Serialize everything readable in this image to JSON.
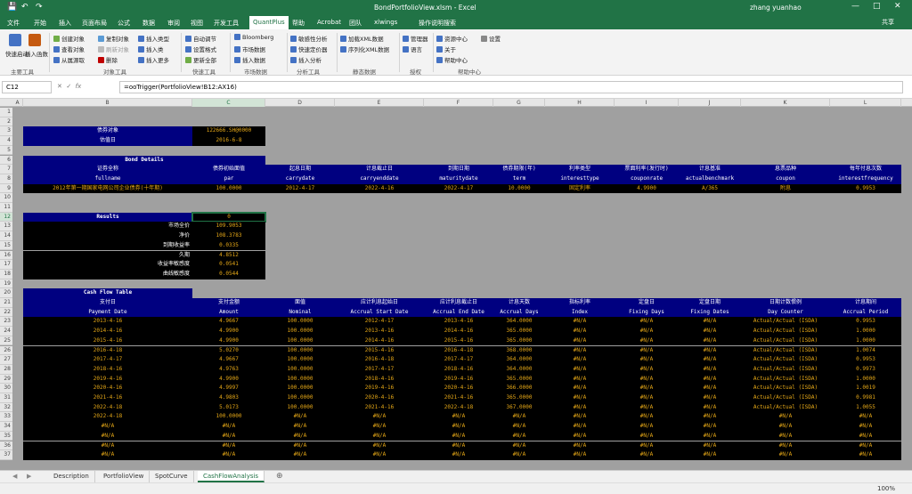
{
  "window": {
    "title": "BondPortfolioView.xlsm  -  Excel",
    "user": "zhang yuanhao"
  },
  "menu_tabs": [
    "文件",
    "开始",
    "插入",
    "页面布局",
    "公式",
    "数据",
    "审阅",
    "视图",
    "开发工具",
    "QuantPlus",
    "帮助",
    "Acrobat",
    "团队",
    "xlwings",
    "操作说明搜索"
  ],
  "active_tab": "QuantPlus",
  "share_label": "共享",
  "ribbon": {
    "groups": [
      {
        "label": "主要工具",
        "items": [
          "快速启动",
          "插入函数"
        ]
      },
      {
        "label": "对象工具",
        "items": [
          "创建对象",
          "查看对象",
          "从属源取",
          "复制对象",
          "刷新对象",
          "删除",
          "插入类型",
          "插入类",
          "插入更多"
        ]
      },
      {
        "label": "快速工具",
        "items": [
          "自动调节",
          "设置格式",
          "更新全部"
        ]
      },
      {
        "label": "市场数据",
        "items": [
          "Bloomberg",
          "市场数据",
          "插入数据"
        ]
      },
      {
        "label": "分析工具",
        "items": [
          "敏感性分析",
          "快速定价器",
          "插入分析"
        ]
      },
      {
        "label": "静态数据",
        "items": [
          "加载XML数据",
          "序列化XML数据"
        ]
      },
      {
        "label": "授权",
        "items": [
          "管理器",
          "语言"
        ]
      },
      {
        "label": "帮助中心",
        "items": [
          "资源中心",
          "关于",
          "帮助中心",
          "设置"
        ]
      }
    ]
  },
  "formula_bar": {
    "name_box": "C12",
    "formula": "=ooTrigger(PortfolioView!B12:AX16)"
  },
  "columns": [
    "A",
    "B",
    "C",
    "D",
    "E",
    "F",
    "G",
    "H",
    "I",
    "J",
    "K",
    "L"
  ],
  "rows": [
    "1",
    "2",
    "3",
    "4",
    "5",
    "6",
    "7",
    "8",
    "9",
    "10",
    "11",
    "12",
    "13",
    "14",
    "15",
    "16",
    "17",
    "18",
    "19",
    "20",
    "21",
    "22",
    "23",
    "24",
    "25",
    "26",
    "27",
    "28",
    "29",
    "30",
    "31",
    "32",
    "33",
    "34",
    "35",
    "36",
    "37"
  ],
  "bond_object": {
    "label1": "债券对象",
    "value1": "122666.SH@0000",
    "label2": "估值日",
    "value2": "2016-6-8"
  },
  "bond_details": {
    "title": "Bond Details",
    "cn_headers": [
      "证券全称",
      "债券初始面值",
      "起息日期",
      "计息截止日",
      "到期日期",
      "债券期限(年)",
      "利率类型",
      "票面利率(发行时)",
      "计息基准",
      "息票品种",
      "每年付息次数"
    ],
    "en_headers": [
      "fullname",
      "par",
      "carrydate",
      "carryenddate",
      "maturitydate",
      "term",
      "interesttype",
      "couponrate",
      "actualbenchmark",
      "coupon",
      "interestfrequency"
    ],
    "values": [
      "2012年第一期国家电网公司企业债券(十年期)",
      "100.0000",
      "2012-4-17",
      "2022-4-16",
      "2022-4-17",
      "10.0000",
      "固定利率",
      "4.9900",
      "A/365",
      "附息",
      "0.9953"
    ]
  },
  "results": {
    "title": "Results",
    "top_value": "0",
    "rows": [
      {
        "label": "市场全价",
        "value": "109.9053"
      },
      {
        "label": "净价",
        "value": "108.3783"
      },
      {
        "label": "到期收益率",
        "value": "0.0335"
      },
      {
        "label": "久期",
        "value": "4.8512"
      },
      {
        "label": "收益率敏感度",
        "value": "0.0541"
      },
      {
        "label": "曲线敏感度",
        "value": "0.0544"
      }
    ]
  },
  "cash_flow": {
    "title": "Cash Flow Table",
    "cn_headers": [
      "支付日",
      "支付金额",
      "面值",
      "应计利息起始日",
      "应计利息截止日",
      "计息天数",
      "指标利率",
      "定盘日",
      "定盘日期",
      "日期计数惯例",
      "计息期间"
    ],
    "en_headers": [
      "Payment Date",
      "Amount",
      "Nominal",
      "Accrual Start Date",
      "Accrual End Date",
      "Accrual Days",
      "Index",
      "Fixing Days",
      "Fixing Dates",
      "Day Counter",
      "Accrual Period"
    ],
    "rows": [
      [
        "2013-4-16",
        "4.9667",
        "100.0000",
        "2012-4-17",
        "2013-4-16",
        "364.0000",
        "#N/A",
        "#N/A",
        "#N/A",
        "Actual/Actual (ISDA)",
        "0.9953"
      ],
      [
        "2014-4-16",
        "4.9900",
        "100.0000",
        "2013-4-16",
        "2014-4-16",
        "365.0000",
        "#N/A",
        "#N/A",
        "#N/A",
        "Actual/Actual (ISDA)",
        "1.0000"
      ],
      [
        "2015-4-16",
        "4.9900",
        "100.0000",
        "2014-4-16",
        "2015-4-16",
        "365.0000",
        "#N/A",
        "#N/A",
        "#N/A",
        "Actual/Actual (ISDA)",
        "1.0000"
      ],
      [
        "2016-4-18",
        "5.0270",
        "100.0000",
        "2015-4-16",
        "2016-4-18",
        "368.0000",
        "#N/A",
        "#N/A",
        "#N/A",
        "Actual/Actual (ISDA)",
        "1.0074"
      ],
      [
        "2017-4-17",
        "4.9667",
        "100.0000",
        "2016-4-18",
        "2017-4-17",
        "364.0000",
        "#N/A",
        "#N/A",
        "#N/A",
        "Actual/Actual (ISDA)",
        "0.9953"
      ],
      [
        "2018-4-16",
        "4.9763",
        "100.0000",
        "2017-4-17",
        "2018-4-16",
        "364.0000",
        "#N/A",
        "#N/A",
        "#N/A",
        "Actual/Actual (ISDA)",
        "0.9973"
      ],
      [
        "2019-4-16",
        "4.9900",
        "100.0000",
        "2018-4-16",
        "2019-4-16",
        "365.0000",
        "#N/A",
        "#N/A",
        "#N/A",
        "Actual/Actual (ISDA)",
        "1.0000"
      ],
      [
        "2020-4-16",
        "4.9997",
        "100.0000",
        "2019-4-16",
        "2020-4-16",
        "366.0000",
        "#N/A",
        "#N/A",
        "#N/A",
        "Actual/Actual (ISDA)",
        "1.0019"
      ],
      [
        "2021-4-16",
        "4.9803",
        "100.0000",
        "2020-4-16",
        "2021-4-16",
        "365.0000",
        "#N/A",
        "#N/A",
        "#N/A",
        "Actual/Actual (ISDA)",
        "0.9981"
      ],
      [
        "2022-4-18",
        "5.0173",
        "100.0000",
        "2021-4-16",
        "2022-4-18",
        "367.0000",
        "#N/A",
        "#N/A",
        "#N/A",
        "Actual/Actual (ISDA)",
        "1.0055"
      ],
      [
        "2022-4-18",
        "100.0000",
        "#N/A",
        "#N/A",
        "#N/A",
        "#N/A",
        "#N/A",
        "#N/A",
        "#N/A",
        "#N/A",
        "#N/A"
      ],
      [
        "#N/A",
        "#N/A",
        "#N/A",
        "#N/A",
        "#N/A",
        "#N/A",
        "#N/A",
        "#N/A",
        "#N/A",
        "#N/A",
        "#N/A"
      ],
      [
        "#N/A",
        "#N/A",
        "#N/A",
        "#N/A",
        "#N/A",
        "#N/A",
        "#N/A",
        "#N/A",
        "#N/A",
        "#N/A",
        "#N/A"
      ],
      [
        "#N/A",
        "#N/A",
        "#N/A",
        "#N/A",
        "#N/A",
        "#N/A",
        "#N/A",
        "#N/A",
        "#N/A",
        "#N/A",
        "#N/A"
      ],
      [
        "#N/A",
        "#N/A",
        "#N/A",
        "#N/A",
        "#N/A",
        "#N/A",
        "#N/A",
        "#N/A",
        "#N/A",
        "#N/A",
        "#N/A"
      ]
    ]
  },
  "sheet_tabs": [
    "Description",
    "PortfolioView",
    "SpotCurve",
    "CashFlowAnalysis"
  ],
  "active_sheet": "CashFlowAnalysis",
  "zoom": "100%",
  "colors": {
    "excel_green": "#217346",
    "navy": "#000080",
    "black": "#000000",
    "orange": "#e6a817",
    "grid_bg": "#a0a0a0"
  }
}
